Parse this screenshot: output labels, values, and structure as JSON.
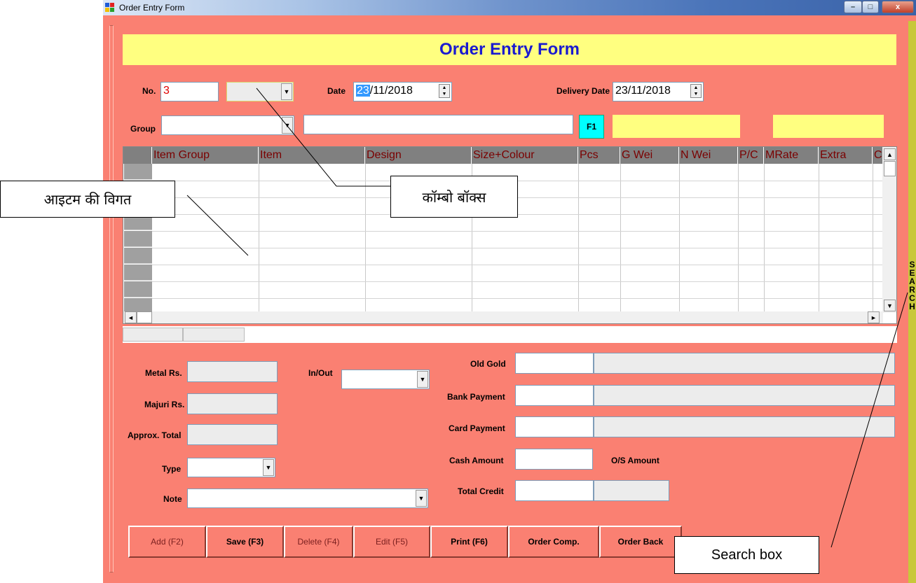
{
  "window": {
    "title": "Order Entry Form",
    "min": "–",
    "max": "□",
    "close": "x"
  },
  "header": {
    "title": "Order Entry Form"
  },
  "top": {
    "no_label": "No.",
    "no_value": "3",
    "date_label": "Date",
    "date_day": "23",
    "date_rest": "/11/2018",
    "delivery_label": "Delivery Date",
    "delivery_value": "23/11/2018",
    "group_label": "Group",
    "f1_label": "F1"
  },
  "grid": {
    "columns": [
      "Item Group",
      "Item",
      "Design",
      "Size+Colour",
      "Pcs",
      "G Wei",
      "N Wei",
      "P/C",
      "MRate",
      "Extra",
      "C"
    ]
  },
  "left_fields": {
    "metal_label": "Metal Rs.",
    "majuri_label": "Majuri Rs.",
    "approx_label": "Approx. Total",
    "type_label": "Type",
    "note_label": "Note",
    "inout_label": "In/Out"
  },
  "payment": {
    "old_gold": "Old Gold",
    "bank": "Bank Payment",
    "card": "Card Payment",
    "cash": "Cash Amount",
    "os_amount": "O/S Amount",
    "total_credit": "Total Credit"
  },
  "buttons": [
    {
      "label": "Add (F2)"
    },
    {
      "label": "Save (F3)"
    },
    {
      "label": "Delete (F4)"
    },
    {
      "label": "Edit (F5)"
    },
    {
      "label": "Print (F6)"
    },
    {
      "label": "Order Comp."
    },
    {
      "label": "Order Back"
    }
  ],
  "search_strip": {
    "letters": [
      "S",
      "E",
      "A",
      "R",
      "C",
      "H"
    ]
  },
  "callouts": {
    "item_details": "आइटम की विगत",
    "combo_box": "कॉम्बो बॉक्स",
    "search_box": "Search  box"
  },
  "colors": {
    "form_bg": "#fa8072",
    "header_bg": "#ffff80",
    "title_blue": "#1a1ad0",
    "f1_bg": "#00ffff"
  }
}
